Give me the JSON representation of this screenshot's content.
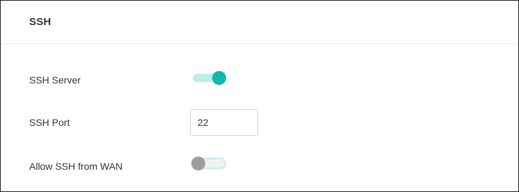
{
  "panel": {
    "title": "SSH"
  },
  "ssh_server": {
    "label": "SSH Server",
    "enabled": true
  },
  "ssh_port": {
    "label": "SSH Port",
    "value": "22"
  },
  "allow_wan": {
    "label": "Allow SSH from WAN",
    "enabled": false
  },
  "colors": {
    "toggle_on_knob": "#10b8b0",
    "toggle_on_track": "#bfeee9",
    "toggle_off_knob": "#9e9e9e",
    "toggle_off_track": "#f1f1f1"
  }
}
